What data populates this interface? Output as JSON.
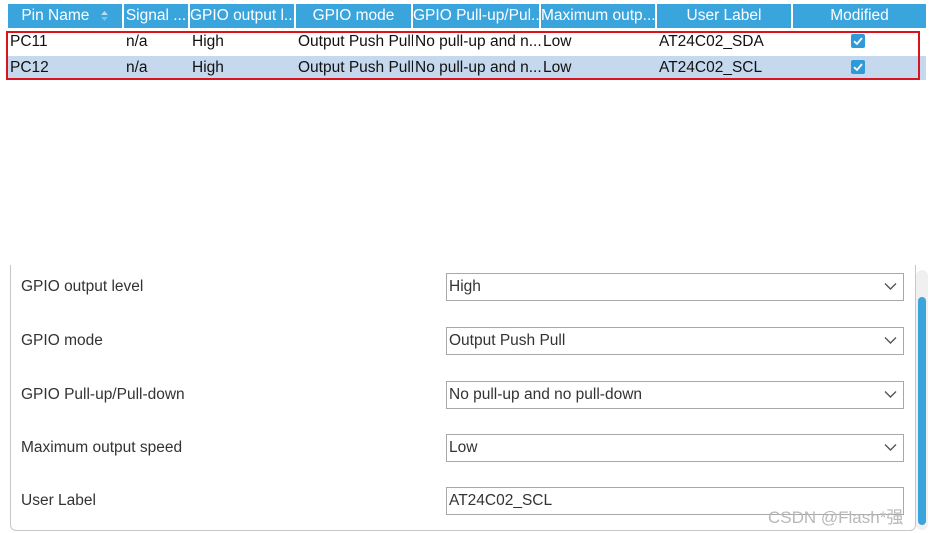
{
  "table": {
    "columns": [
      {
        "label": "Pin Name",
        "sortable": true
      },
      {
        "label": "Signal ..."
      },
      {
        "label": "GPIO output l..."
      },
      {
        "label": "GPIO mode"
      },
      {
        "label": "GPIO Pull-up/Pul..."
      },
      {
        "label": "Maximum outp..."
      },
      {
        "label": "User Label"
      },
      {
        "label": "Modified"
      }
    ],
    "rows": [
      {
        "pin": "PC11",
        "signal": "n/a",
        "output_level": "High",
        "mode": "Output Push Pull",
        "pull": "No pull-up and n...",
        "speed": "Low",
        "user_label": "AT24C02_SDA",
        "modified": true
      },
      {
        "pin": "PC12",
        "signal": "n/a",
        "output_level": "High",
        "mode": "Output Push Pull",
        "pull": "No pull-up and n...",
        "speed": "Low",
        "user_label": "AT24C02_SCL",
        "modified": true
      }
    ]
  },
  "properties": {
    "output_level": {
      "label": "GPIO output level",
      "value": "High"
    },
    "mode": {
      "label": "GPIO mode",
      "value": "Output Push Pull"
    },
    "pull": {
      "label": "GPIO Pull-up/Pull-down",
      "value": "No pull-up and no pull-down"
    },
    "speed": {
      "label": "Maximum output speed",
      "value": "Low"
    },
    "user_label": {
      "label": "User Label",
      "value": "AT24C02_SCL"
    }
  },
  "watermark": "CSDN @Flash*强",
  "colors": {
    "header": "#3aa5dc",
    "selected_row": "#c5d8ee",
    "highlight_frame": "#d9141f",
    "checkbox": "#2e9ad8"
  },
  "icons": [
    "sort-icon",
    "checkbox-checked-icon",
    "chevron-down-icon"
  ]
}
